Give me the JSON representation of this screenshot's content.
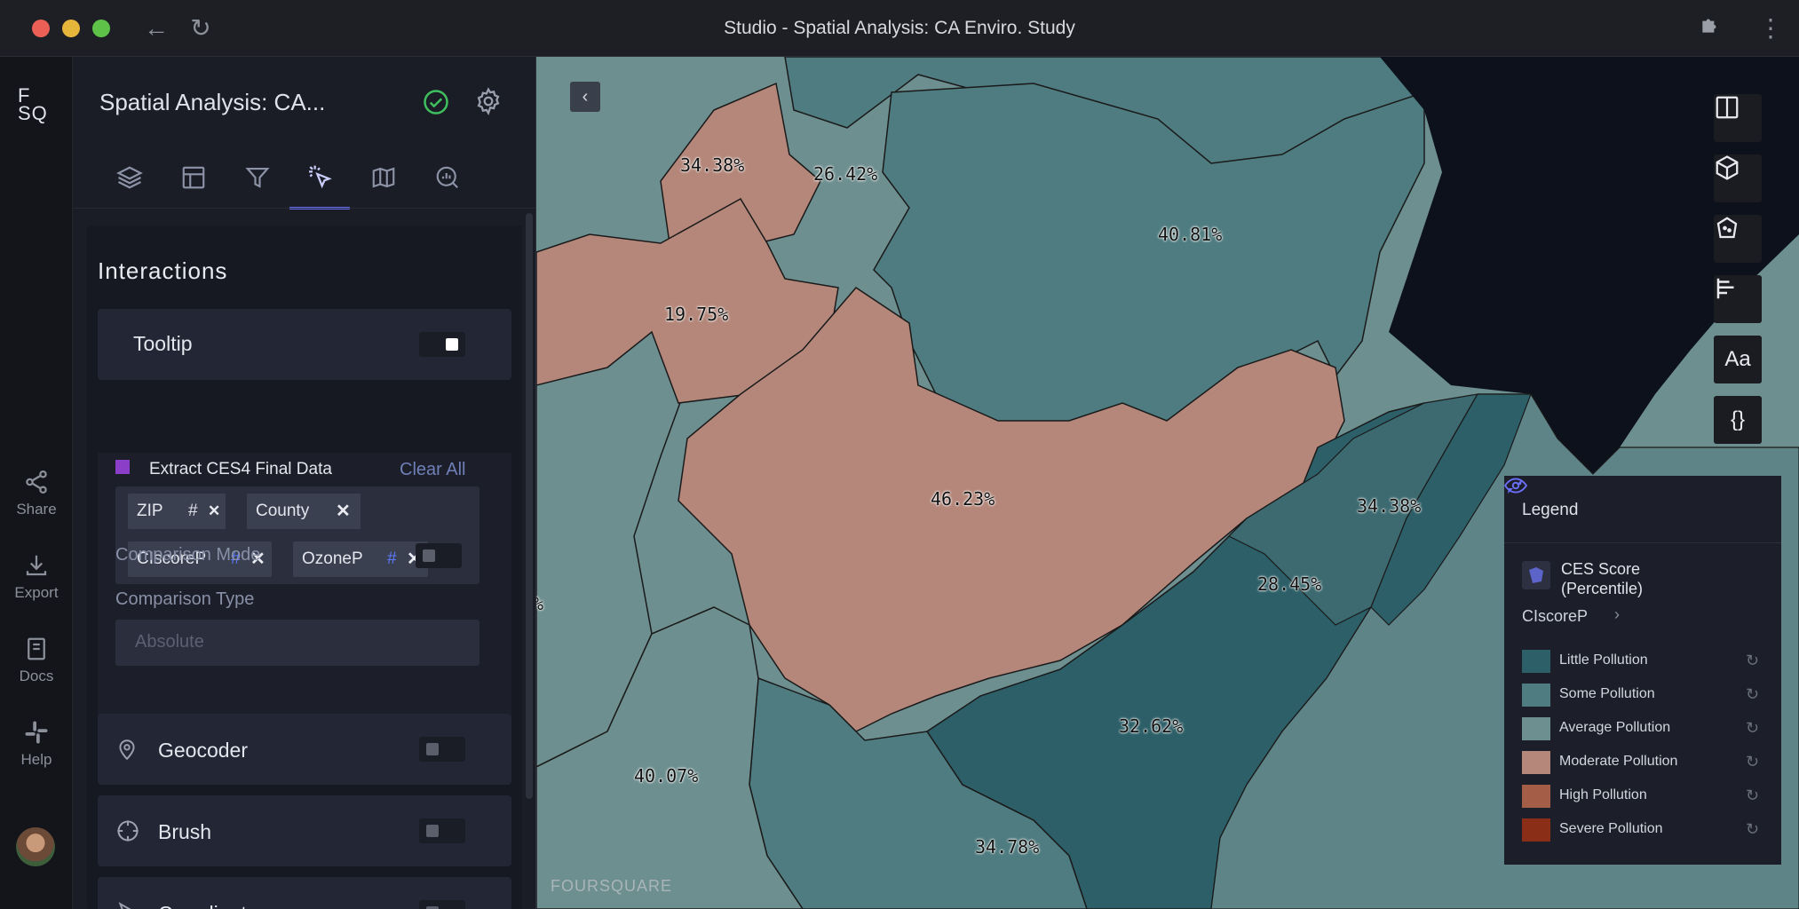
{
  "window": {
    "title": "Studio - Spatial Analysis: CA Enviro. Study"
  },
  "rail": {
    "logo": "F SQ",
    "items": [
      {
        "label": "Share",
        "icon": "share-icon"
      },
      {
        "label": "Export",
        "icon": "download-icon"
      },
      {
        "label": "Docs",
        "icon": "book-icon"
      },
      {
        "label": "Help",
        "icon": "slack-icon"
      }
    ]
  },
  "panel": {
    "project_title": "Spatial Analysis: CA...",
    "tabs": [
      "layers",
      "table",
      "filters",
      "interactions",
      "basemap",
      "analysis"
    ],
    "active_tab": "interactions",
    "section_title": "Interactions",
    "tooltip": {
      "label": "Tooltip",
      "enabled": true,
      "dataset_name": "Extract CES4 Final Data",
      "dataset_color": "#8b3fc9",
      "clear_all": "Clear All",
      "fields": [
        {
          "name": "ZIP",
          "type_icon": "#"
        },
        {
          "name": "County",
          "type_icon": ""
        },
        {
          "name": "CIscoreP",
          "type_icon": "#"
        },
        {
          "name": "OzoneP",
          "type_icon": "#"
        }
      ],
      "comparison_mode_label": "Comparison Mode",
      "comparison_mode_enabled": false,
      "comparison_type_label": "Comparison Type",
      "comparison_type_placeholder": "Absolute"
    },
    "geocoder": {
      "label": "Geocoder",
      "enabled": false
    },
    "brush": {
      "label": "Brush",
      "enabled": false
    },
    "coordinates": {
      "label": "Coordinates",
      "enabled": false
    }
  },
  "map": {
    "collapse_glyph": "‹",
    "watermark": "FOURSQUARE",
    "controls": [
      "split-map-icon",
      "3d-cube-icon",
      "draw-polygon-icon",
      "legend-bars-icon",
      "Aa",
      "{}"
    ],
    "labels": [
      "34.38%",
      "26.42%",
      "40.81%",
      "19.75%",
      "46.23%",
      "34.38%",
      "28.45%",
      "%",
      "32.62%",
      "40.07%",
      "34.78%"
    ],
    "legend": {
      "title": "Legend",
      "layer_name": "CES Score (Percentile)",
      "field": "CIscoreP",
      "items": [
        {
          "label": "Little Pollution",
          "color": "#2d5f68"
        },
        {
          "label": "Some Pollution",
          "color": "#4f7c80"
        },
        {
          "label": "Average Pollution",
          "color": "#6e8f90"
        },
        {
          "label": "Moderate Pollution",
          "color": "#b4877a"
        },
        {
          "label": "High Pollution",
          "color": "#a45e47"
        },
        {
          "label": "Severe Pollution",
          "color": "#8a2e18"
        }
      ]
    }
  }
}
